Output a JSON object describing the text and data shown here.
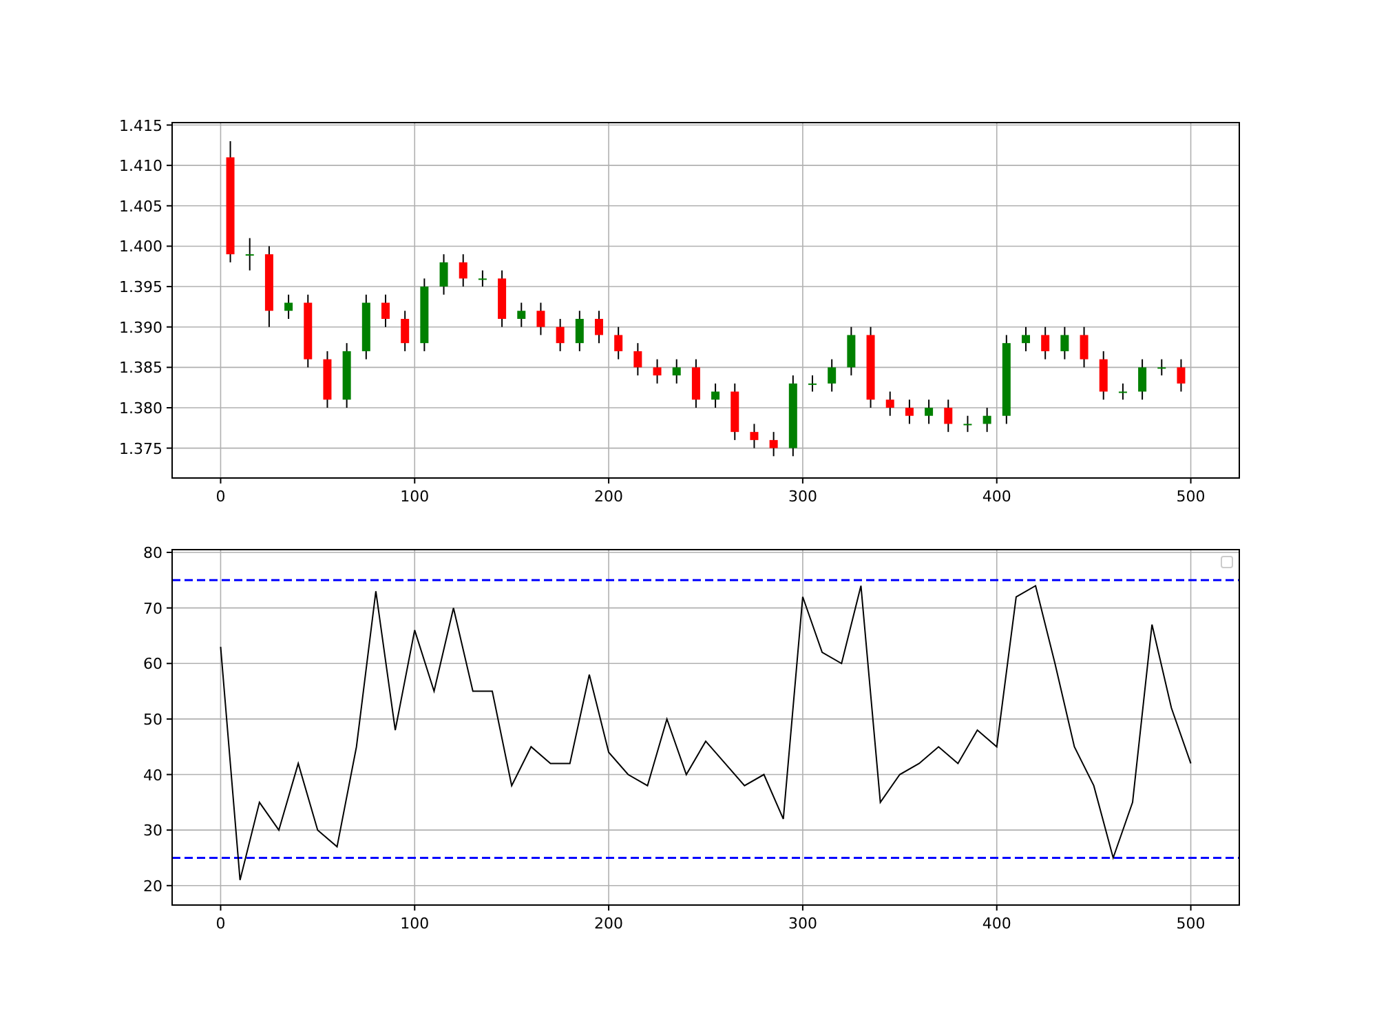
{
  "price_chart": {
    "chart_data": {
      "type": "candlestick",
      "grid": true,
      "x": [
        5,
        15,
        25,
        35,
        45,
        55,
        65,
        75,
        85,
        95,
        105,
        115,
        125,
        135,
        145,
        155,
        165,
        175,
        185,
        195,
        205,
        215,
        225,
        235,
        245,
        255,
        265,
        275,
        285,
        295,
        305,
        315,
        325,
        335,
        345,
        355,
        365,
        375,
        385,
        395,
        405,
        415,
        425,
        435,
        445,
        455,
        465,
        475,
        485,
        495
      ],
      "ohlc": [
        [
          1.411,
          1.413,
          1.398,
          1.399
        ],
        [
          1.399,
          1.401,
          1.397,
          1.399
        ],
        [
          1.399,
          1.4,
          1.39,
          1.392
        ],
        [
          1.392,
          1.394,
          1.391,
          1.393
        ],
        [
          1.393,
          1.394,
          1.385,
          1.386
        ],
        [
          1.386,
          1.387,
          1.38,
          1.381
        ],
        [
          1.381,
          1.388,
          1.38,
          1.387
        ],
        [
          1.387,
          1.394,
          1.386,
          1.393
        ],
        [
          1.393,
          1.394,
          1.39,
          1.391
        ],
        [
          1.391,
          1.392,
          1.387,
          1.388
        ],
        [
          1.388,
          1.396,
          1.387,
          1.395
        ],
        [
          1.395,
          1.399,
          1.394,
          1.398
        ],
        [
          1.398,
          1.399,
          1.395,
          1.396
        ],
        [
          1.396,
          1.397,
          1.395,
          1.396
        ],
        [
          1.396,
          1.397,
          1.39,
          1.391
        ],
        [
          1.391,
          1.393,
          1.39,
          1.392
        ],
        [
          1.392,
          1.393,
          1.389,
          1.39
        ],
        [
          1.39,
          1.391,
          1.387,
          1.388
        ],
        [
          1.388,
          1.392,
          1.387,
          1.391
        ],
        [
          1.391,
          1.392,
          1.388,
          1.389
        ],
        [
          1.389,
          1.39,
          1.386,
          1.387
        ],
        [
          1.387,
          1.388,
          1.384,
          1.385
        ],
        [
          1.385,
          1.386,
          1.383,
          1.384
        ],
        [
          1.384,
          1.386,
          1.383,
          1.385
        ],
        [
          1.385,
          1.386,
          1.38,
          1.381
        ],
        [
          1.381,
          1.383,
          1.38,
          1.382
        ],
        [
          1.382,
          1.383,
          1.376,
          1.377
        ],
        [
          1.377,
          1.378,
          1.375,
          1.376
        ],
        [
          1.376,
          1.377,
          1.374,
          1.375
        ],
        [
          1.375,
          1.384,
          1.374,
          1.383
        ],
        [
          1.383,
          1.384,
          1.382,
          1.383
        ],
        [
          1.383,
          1.386,
          1.382,
          1.385
        ],
        [
          1.385,
          1.39,
          1.384,
          1.389
        ],
        [
          1.389,
          1.39,
          1.38,
          1.381
        ],
        [
          1.381,
          1.382,
          1.379,
          1.38
        ],
        [
          1.38,
          1.381,
          1.378,
          1.379
        ],
        [
          1.379,
          1.381,
          1.378,
          1.38
        ],
        [
          1.38,
          1.381,
          1.377,
          1.378
        ],
        [
          1.378,
          1.379,
          1.377,
          1.378
        ],
        [
          1.378,
          1.38,
          1.377,
          1.379
        ],
        [
          1.379,
          1.389,
          1.378,
          1.388
        ],
        [
          1.388,
          1.39,
          1.387,
          1.389
        ],
        [
          1.389,
          1.39,
          1.386,
          1.387
        ],
        [
          1.387,
          1.39,
          1.386,
          1.389
        ],
        [
          1.389,
          1.39,
          1.385,
          1.386
        ],
        [
          1.386,
          1.387,
          1.381,
          1.382
        ],
        [
          1.382,
          1.383,
          1.381,
          1.382
        ],
        [
          1.382,
          1.386,
          1.381,
          1.385
        ],
        [
          1.385,
          1.386,
          1.384,
          1.385
        ],
        [
          1.385,
          1.386,
          1.382,
          1.383
        ]
      ],
      "xlim": [
        -25,
        525
      ],
      "ylim": [
        1.3713,
        1.4153
      ],
      "xticks": [
        0,
        100,
        200,
        300,
        400,
        500
      ],
      "yticks": [
        {
          "value": 1.375,
          "label": "1.375"
        },
        {
          "value": 1.38,
          "label": "1.380"
        },
        {
          "value": 1.385,
          "label": "1.385"
        },
        {
          "value": 1.39,
          "label": "1.390"
        },
        {
          "value": 1.395,
          "label": "1.395"
        },
        {
          "value": 1.4,
          "label": "1.400"
        },
        {
          "value": 1.405,
          "label": "1.405"
        },
        {
          "value": 1.41,
          "label": "1.410"
        },
        {
          "value": 1.415,
          "label": "1.415"
        }
      ]
    }
  },
  "indicator_chart": {
    "chart_data": {
      "type": "line",
      "grid": true,
      "x": [
        0,
        10,
        20,
        30,
        40,
        50,
        60,
        70,
        80,
        90,
        100,
        110,
        120,
        130,
        140,
        150,
        160,
        170,
        180,
        190,
        200,
        210,
        220,
        230,
        240,
        250,
        260,
        270,
        280,
        290,
        300,
        310,
        320,
        330,
        340,
        350,
        360,
        370,
        380,
        390,
        400,
        410,
        420,
        430,
        440,
        450,
        460,
        470,
        480,
        490,
        500
      ],
      "series": [
        {
          "color": "#000000",
          "values": [
            63,
            21,
            35,
            30,
            42,
            30,
            27,
            45,
            73,
            48,
            66,
            55,
            70,
            55,
            55,
            38,
            45,
            42,
            42,
            58,
            44,
            40,
            38,
            50,
            40,
            46,
            42,
            38,
            40,
            32,
            72,
            62,
            60,
            74,
            35,
            40,
            42,
            45,
            42,
            48,
            45,
            72,
            74,
            60,
            45,
            38,
            25,
            35,
            67,
            52,
            42
          ]
        }
      ],
      "xlim": [
        -25,
        525
      ],
      "ylim": [
        16.5,
        80.5
      ],
      "xticks": [
        0,
        100,
        200,
        300,
        400,
        500
      ],
      "yticks": [
        20,
        30,
        40,
        50,
        60,
        70,
        80
      ],
      "ref_lines": [
        {
          "axis": "y",
          "value": 75,
          "color": "#0000ff"
        },
        {
          "axis": "y",
          "value": 25,
          "color": "#0000ff"
        }
      ]
    }
  }
}
